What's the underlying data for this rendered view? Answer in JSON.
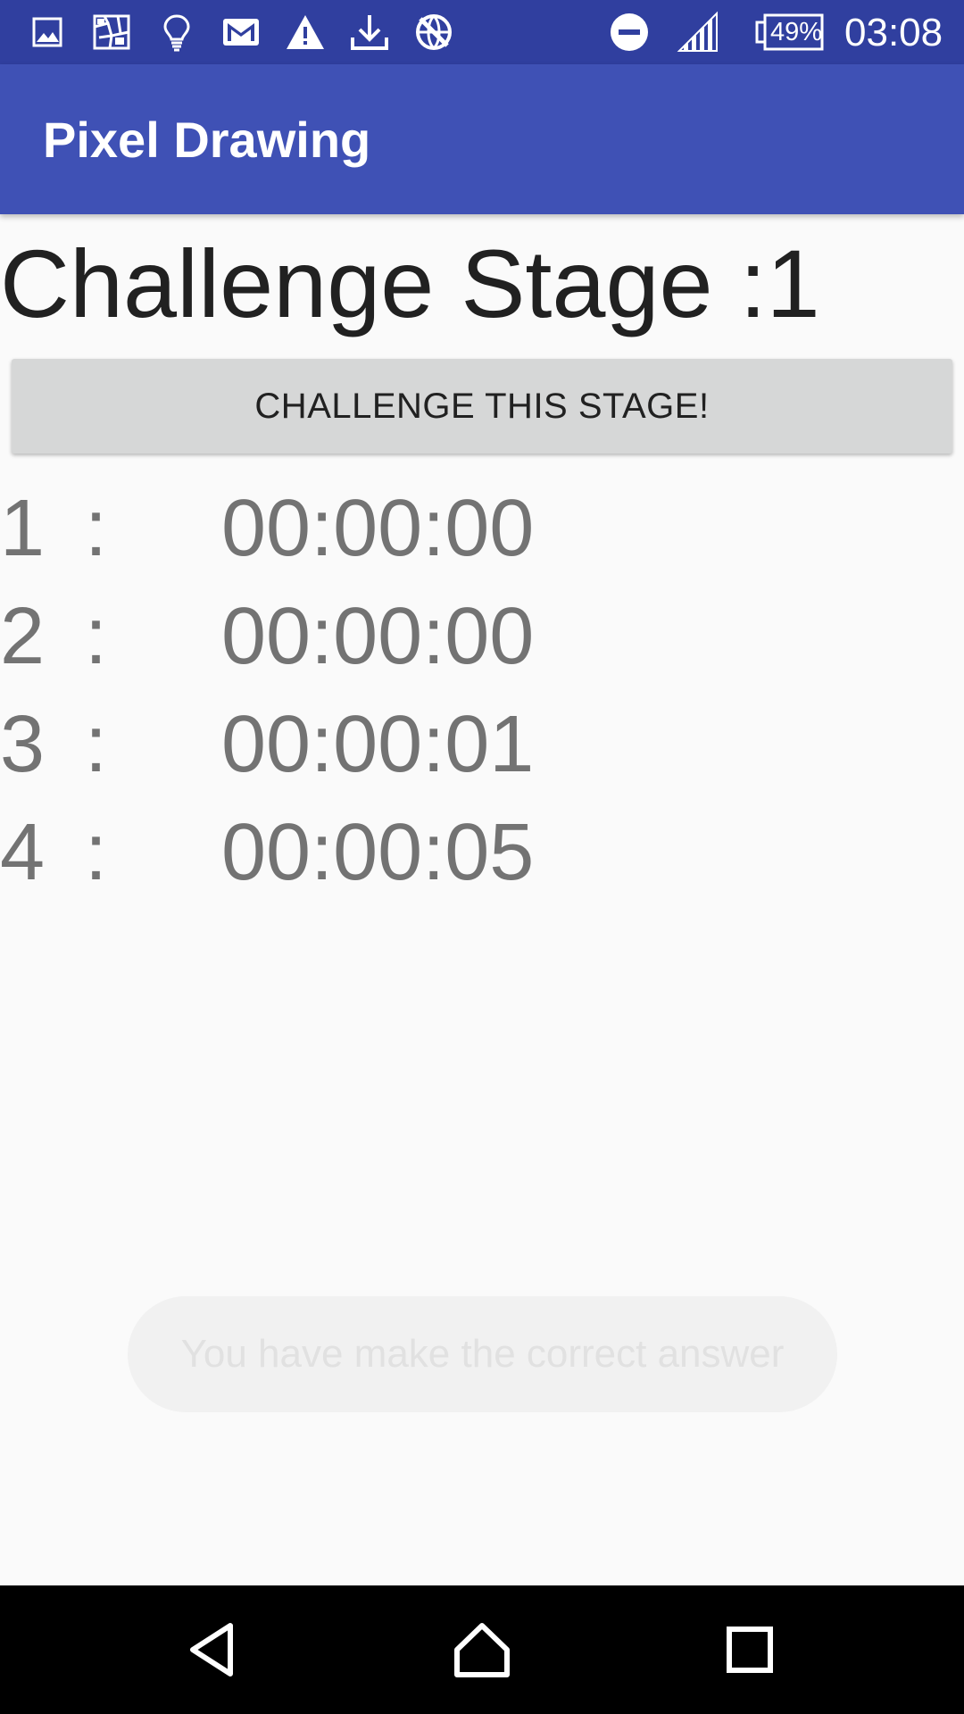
{
  "status_bar": {
    "left_icons": [
      "image-icon",
      "pattern-icon",
      "lightbulb-icon",
      "gmail-icon",
      "warning-icon",
      "download-icon",
      "no-network-icon"
    ],
    "right_icons": [
      "do-not-disturb-icon",
      "signal-icon"
    ],
    "battery": "49%",
    "time": "03:08"
  },
  "app_bar": {
    "title": "Pixel Drawing"
  },
  "stage": {
    "title": "Challenge Stage :1"
  },
  "challenge_button": {
    "label": "CHALLENGE THIS STAGE!"
  },
  "times": [
    {
      "rank": "1",
      "sep": ":",
      "value": "00:00:00"
    },
    {
      "rank": "2",
      "sep": ":",
      "value": "00:00:00"
    },
    {
      "rank": "3",
      "sep": ":",
      "value": "00:00:01"
    },
    {
      "rank": "4",
      "sep": ":",
      "value": "00:00:05"
    }
  ],
  "toast": {
    "message": "You have make the correct answer"
  },
  "nav_bar": {
    "buttons": [
      "back-icon",
      "home-icon",
      "recents-icon"
    ]
  },
  "colors": {
    "status_bar": "#303f9f",
    "app_bar": "#3f51b5",
    "background": "#fafafa",
    "button": "#d6d7d7"
  }
}
